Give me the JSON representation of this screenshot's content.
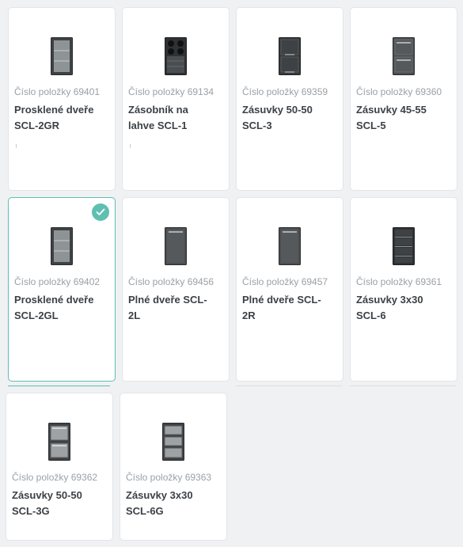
{
  "accent_color": "#5fbfb3",
  "products": [
    {
      "item_no": "Číslo položky 69401",
      "name": "Prosklené dveře SCL-2GR",
      "icon": "glass-door-icon"
    },
    {
      "item_no": "Číslo položky 69134",
      "name": "Zásobník na lahve SCL-1",
      "icon": "bottle-rack-icon"
    },
    {
      "item_no": "Číslo položky 69359",
      "name": "Zásuvky 50-50 SCL-3",
      "icon": "drawers-2-icon"
    },
    {
      "item_no": "Číslo položky 69360",
      "name": "Zásuvky 45-55 SCL-5",
      "icon": "drawers-2-icon"
    },
    {
      "item_no": "Číslo položky 69402",
      "name": "Prosklené dveře SCL-2GL",
      "icon": "glass-door-icon",
      "selected": true
    },
    {
      "item_no": "Číslo položky 69456",
      "name": "Plné dveře SCL-2L",
      "icon": "solid-door-icon"
    },
    {
      "item_no": "Číslo položky 69457",
      "name": "Plné dveře SCL-2R",
      "icon": "solid-door-icon"
    },
    {
      "item_no": "Číslo položky 69361",
      "name": "Zásuvky 3x30 SCL-6",
      "icon": "drawers-3-icon"
    },
    {
      "item_no": "Číslo položky 69362",
      "name": "Zásuvky 50-50 SCL-3G",
      "icon": "glass-drawers-2-icon"
    },
    {
      "item_no": "Číslo položky 69363",
      "name": "Zásuvky 3x30 SCL-6G",
      "icon": "glass-drawers-3-icon"
    }
  ]
}
